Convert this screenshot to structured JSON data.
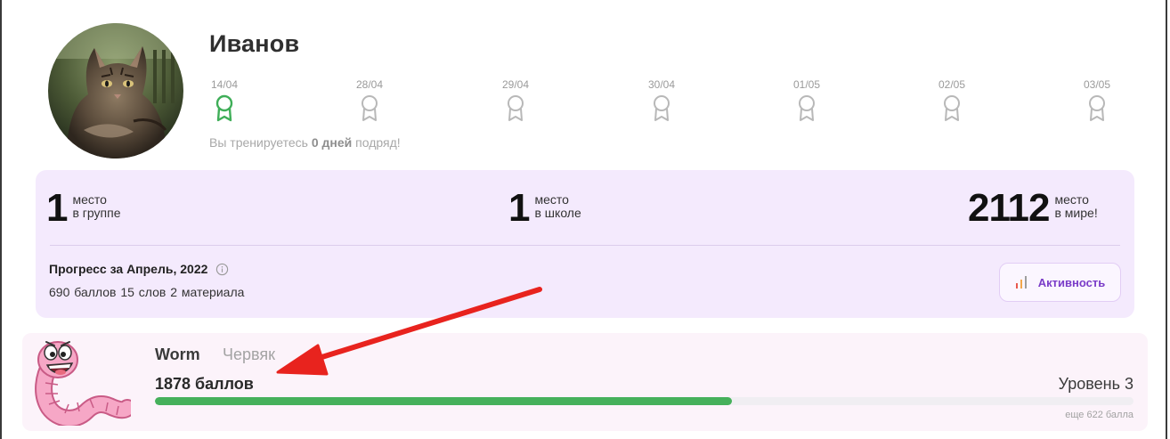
{
  "profile": {
    "name": "Иванов",
    "streak": {
      "days": [
        {
          "date": "14/04",
          "done": true
        },
        {
          "date": "28/04",
          "done": false
        },
        {
          "date": "29/04",
          "done": false
        },
        {
          "date": "30/04",
          "done": false
        },
        {
          "date": "01/05",
          "done": false
        },
        {
          "date": "02/05",
          "done": false
        },
        {
          "date": "03/05",
          "done": false
        }
      ],
      "text_prefix": "Вы тренируетесь ",
      "text_count": "0 дней",
      "text_suffix": " подряд!"
    }
  },
  "ranks": [
    {
      "number": "1",
      "line1": "место",
      "line2": "в группе"
    },
    {
      "number": "1",
      "line1": "место",
      "line2": "в школе"
    },
    {
      "number": "2112",
      "line1": "место",
      "line2": "в мире!"
    }
  ],
  "progress": {
    "title": "Прогресс за Апрель, 2022",
    "stats": "690 баллов  15 слов  2 материала",
    "activity_label": "Активность"
  },
  "level": {
    "name_en": "Worm",
    "name_ru": "Червяк",
    "points": "1878 баллов",
    "level_label": "Уровень 3",
    "remaining": "еще 622 балла",
    "progress_fraction": 0.59
  },
  "colors": {
    "streak_active": "#3fae58",
    "streak_inactive": "#b8b8b8",
    "stats_bg": "#f4eafd",
    "level_bg": "#fcf3fa",
    "progress_green": "#46b05b",
    "accent_purple": "#7a3cc8",
    "annotation_red": "#e8231e"
  },
  "icons": {
    "streak": "award-ribbon-icon",
    "info": "info-circle-icon",
    "activity": "bar-chart-icon",
    "mascot": "worm-mascot",
    "avatar": "cat-photo"
  }
}
